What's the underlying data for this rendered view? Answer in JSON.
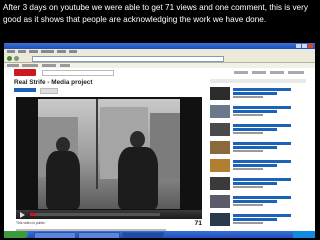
{
  "caption": "After 3 days on youtube we were able to get 71 views and one comment, this is very good as it shows that people are acknowledging the work we have done.",
  "video": {
    "title": "Real Strife - Media project",
    "views": "71",
    "public_note": "This video is public."
  }
}
